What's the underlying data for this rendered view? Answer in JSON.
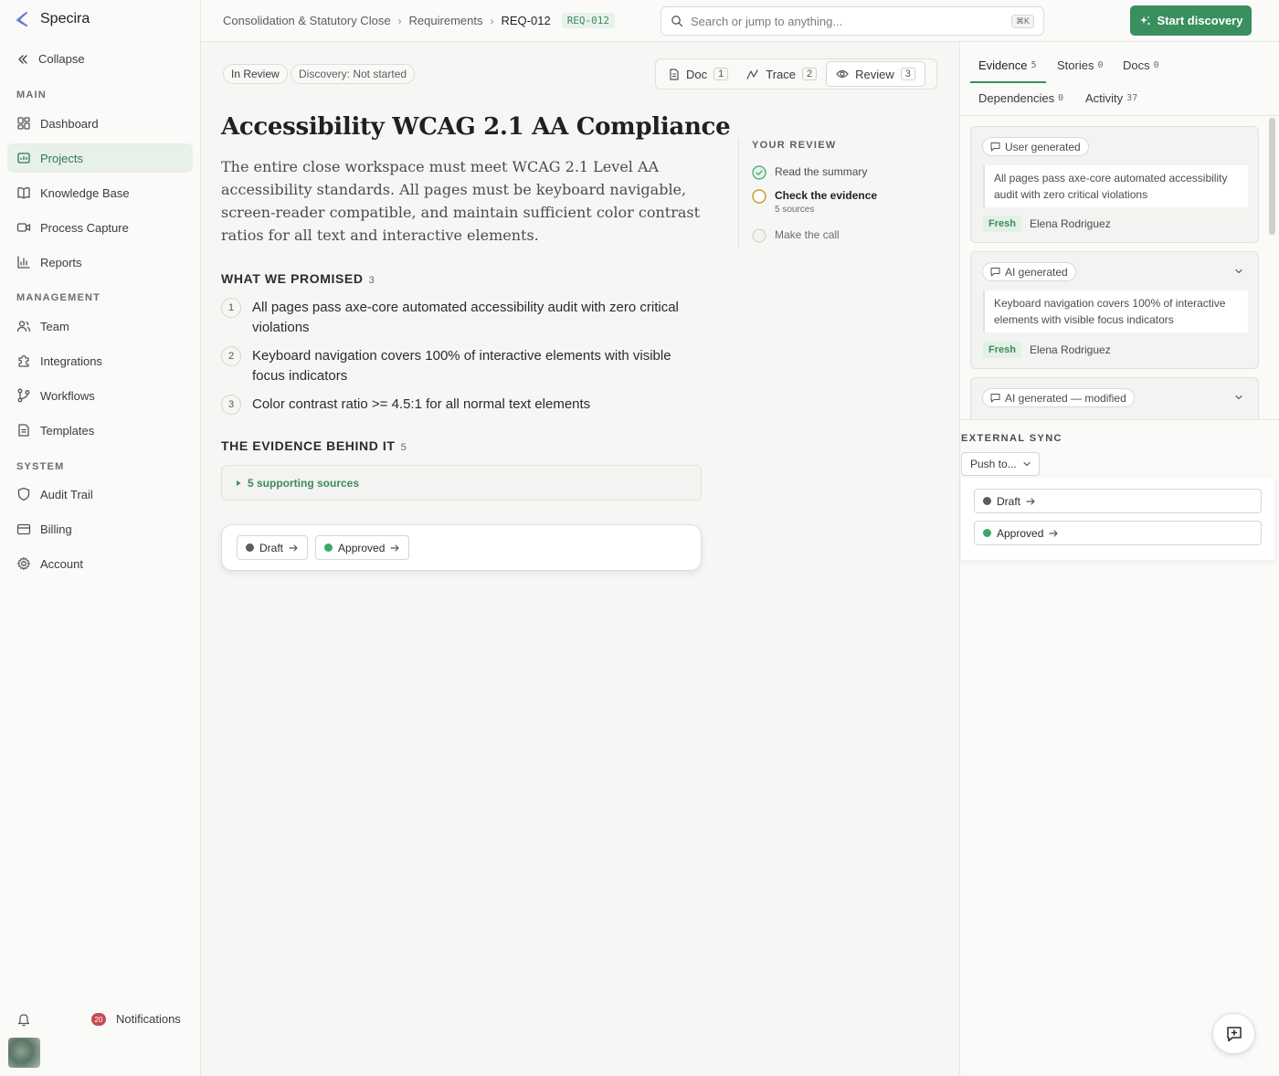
{
  "app": {
    "name": "Specira"
  },
  "sidebar": {
    "collapse_label": "Collapse",
    "sections": [
      {
        "label": "MAIN",
        "items": [
          "Dashboard",
          "Projects",
          "Knowledge Base",
          "Process Capture",
          "Reports"
        ]
      },
      {
        "label": "MANAGEMENT",
        "items": [
          "Team",
          "Integrations",
          "Workflows",
          "Templates"
        ]
      },
      {
        "label": "SYSTEM",
        "items": [
          "Audit Trail",
          "Billing",
          "Account"
        ]
      }
    ],
    "active_item": "Projects",
    "notifications": {
      "count": "20",
      "label": "Notifications"
    }
  },
  "header": {
    "breadcrumb": [
      "Consolidation & Statutory Close",
      "Requirements",
      "REQ-012"
    ],
    "breadcrumb_sep": "›",
    "req_tag": "REQ-012",
    "search_placeholder": "Search or jump to anything...",
    "search_shortcut": "⌘K",
    "start_button": "Start discovery"
  },
  "main": {
    "status_pill": "In Review",
    "discovery_pill": "Discovery: Not started",
    "modes": [
      {
        "label": "Doc",
        "num": "1"
      },
      {
        "label": "Trace",
        "num": "2"
      },
      {
        "label": "Review",
        "num": "3"
      }
    ],
    "active_mode": "Review",
    "title": "Accessibility WCAG 2.1 AA Compliance",
    "description": "The entire close workspace must meet WCAG 2.1 Level AA accessibility standards. All pages must be keyboard navigable, screen-reader compatible, and maintain sufficient color contrast ratios for all text and interactive elements.",
    "promised": {
      "heading": "WHAT WE PROMISED",
      "count": "3",
      "items": [
        {
          "num": "1",
          "text": "All pages pass axe-core automated accessibility audit with zero critical violations"
        },
        {
          "num": "2",
          "text": "Keyboard navigation covers 100% of interactive elements with visible focus indicators"
        },
        {
          "num": "3",
          "text": "Color contrast ratio >= 4.5:1 for all normal text elements"
        }
      ]
    },
    "evidence": {
      "heading": "THE EVIDENCE BEHIND IT",
      "count": "5",
      "sources_label": "5 supporting sources"
    },
    "actions": [
      {
        "label": "Draft",
        "color": "#5a5d5b"
      },
      {
        "label": "Approved",
        "color": "#3aa86a"
      }
    ],
    "review": {
      "heading": "YOUR REVIEW",
      "steps": [
        {
          "label": "Read the summary",
          "state": "done"
        },
        {
          "label": "Check the evidence",
          "sub": "5 sources",
          "state": "current"
        },
        {
          "label": "Make the call",
          "state": "todo"
        }
      ]
    }
  },
  "right_panel": {
    "tabs": [
      {
        "label": "Evidence",
        "count": "5"
      },
      {
        "label": "Stories",
        "count": "0"
      },
      {
        "label": "Docs",
        "count": "0"
      },
      {
        "label": "Dependencies",
        "count": "0"
      },
      {
        "label": "Activity",
        "count": "37"
      }
    ],
    "active_tab": "Evidence",
    "evidence_cards": [
      {
        "tag": "User generated",
        "quote": "All pages pass axe-core automated accessibility audit with zero critical violations",
        "freshness": "Fresh",
        "author": "Elena Rodriguez"
      },
      {
        "tag": "AI generated",
        "quote": "Keyboard navigation covers 100% of interactive elements with visible focus indicators",
        "freshness": "Fresh",
        "author": "Elena Rodriguez"
      },
      {
        "tag": "AI generated — modified"
      }
    ],
    "external_sync": {
      "heading": "EXTERNAL SYNC",
      "push_label": "Push to...",
      "options": [
        {
          "label": "Draft",
          "color": "#5a5d5b"
        },
        {
          "label": "Approved",
          "color": "#3aa86a"
        }
      ]
    }
  },
  "colors": {
    "accent": "#3a8f5f",
    "active_bg": "#e8f0ea",
    "badge": "#c64b55",
    "current_step": "#c79a2e"
  }
}
